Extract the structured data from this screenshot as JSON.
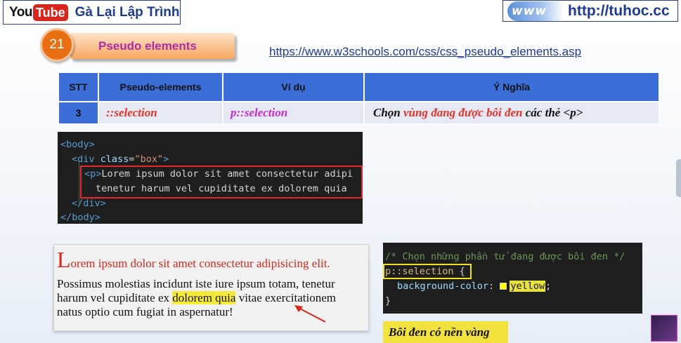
{
  "header": {
    "youtube_you": "You",
    "youtube_tube": "Tube",
    "channel_name": "Gà Lại Lập Trình",
    "www_logo": "www",
    "site_url": "http://tuhoc.cc"
  },
  "lesson": {
    "number": "21",
    "title": "Pseudo elements",
    "reference_link": "https://www.w3schools.com/css/css_pseudo_elements.asp"
  },
  "table": {
    "headers": [
      "STT",
      "Pseudo-elements",
      "Ví dụ",
      "Ý Nghĩa"
    ],
    "row": {
      "stt": "3",
      "pseudo_element": "::selection",
      "example": "p::selection",
      "meaning_prefix": "Chọn ",
      "meaning_highlight": "vùng đang được bôi đen",
      "meaning_suffix": " các thẻ <p>"
    }
  },
  "html_code": {
    "lines": [
      "<body>",
      "<div class=\"box\">",
      "<p>Lorem ipsum dolor sit amet consectetur adipi",
      "tenetur harum vel cupiditate ex dolorem quia",
      "</div>",
      "</body>"
    ],
    "parts": {
      "body_open": "<body>",
      "div_open_tag": "<div",
      "div_attr": "class",
      "div_eq": "=",
      "div_val": "\"box\"",
      "div_close_bracket": ">",
      "p_open": "<p>",
      "line3_text": "Lorem ipsum dolor sit amet consectetur adipi",
      "line4_text": "tenetur harum vel cupiditate ex dolorem quia",
      "div_close": "</div>",
      "body_close": "</body>"
    }
  },
  "preview": {
    "dropcap": "L",
    "first_line_rest": "orem ipsum dolor sit amet consectetur adipisicing elit.",
    "line2": "Possimus molestias incidunt iste iure ipsum totam, tenetur",
    "line3_before": "harum vel cupiditate ex ",
    "line3_selected": "dolorem quia",
    "line3_after": " vitae exercitationem",
    "line4": "natus optio cum fugiat in aspernatur!",
    "selection_color": "#f7ea3a"
  },
  "css_code": {
    "comment": "/* Chọn những phần tử đang được bôi đen */",
    "selector": "p::selection",
    "brace_open": " {",
    "property": "background-color",
    "colon": ": ",
    "value": "yellow",
    "semicolon": ";",
    "brace_close": "}"
  },
  "caption": "Bôi đen có nền vàng",
  "colors": {
    "table_header": "#3c6ed7",
    "highlight_red": "#e3342b",
    "highlight_pink": "#c62bd0",
    "lesson_badge": "#f8a860",
    "yellow": "#f3e23d"
  },
  "icons": [
    "youtube-logo",
    "www-globe-logo",
    "channel-avatar"
  ]
}
